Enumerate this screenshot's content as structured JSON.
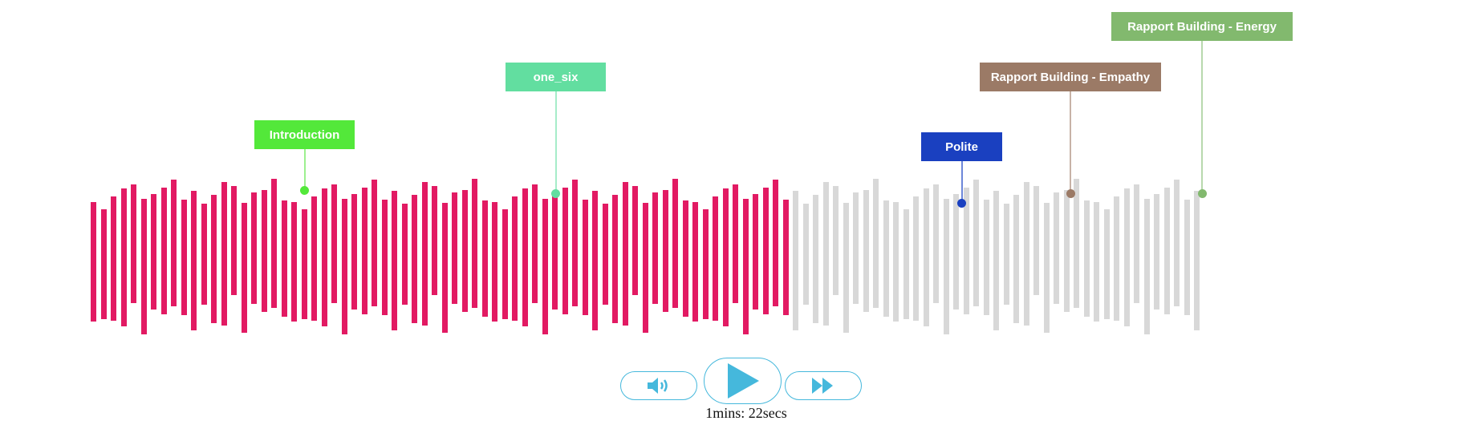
{
  "player": {
    "duration_label": "1mins: 22secs",
    "progress": 0.63,
    "played_color": "#e21a63",
    "unplayed_color": "#d8d8d8",
    "accent_color": "#45b8dc"
  },
  "controls": {
    "volume_icon": "speaker-volume-icon",
    "play_icon": "play-icon",
    "forward_icon": "fast-forward-icon"
  },
  "tags": [
    {
      "label": "Introduction",
      "color": "#53e83a",
      "line_color": "#9df08f"
    },
    {
      "label": "one_six",
      "color": "#62dea0",
      "line_color": "#a6ecc9"
    },
    {
      "label": "Polite",
      "color": "#1a40c0",
      "line_color": "#6d87d9"
    },
    {
      "label": "Rapport Building - Empathy",
      "color": "#9b7a66",
      "line_color": "#c7b2a6"
    },
    {
      "label": "Rapport Building - Energy",
      "color": "#82b96e",
      "line_color": "#b8d9ad"
    }
  ]
}
